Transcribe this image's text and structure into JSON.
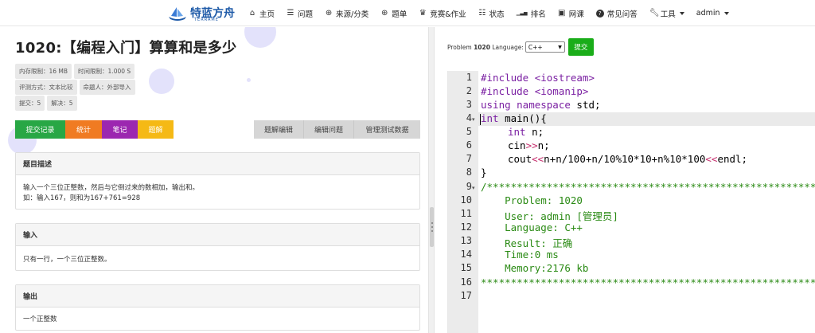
{
  "brand": {
    "name": "特蓝方舟",
    "sub": "TERRAME"
  },
  "nav": {
    "items": [
      {
        "icon": "home-icon",
        "glyph": "⌂",
        "label": "主页"
      },
      {
        "icon": "list-icon",
        "glyph": "☰",
        "label": "问题"
      },
      {
        "icon": "globe-icon",
        "glyph": "⊕",
        "label": "来源/分类"
      },
      {
        "icon": "globe-icon",
        "glyph": "⊕",
        "label": "题单"
      },
      {
        "icon": "trophy-icon",
        "glyph": "♛",
        "label": "竞赛&作业"
      },
      {
        "icon": "list-ol-icon",
        "glyph": "☷",
        "label": "状态"
      },
      {
        "icon": "signal-icon",
        "glyph": "▁▃▅",
        "label": "排名"
      },
      {
        "icon": "video-icon",
        "glyph": "▣",
        "label": "网课"
      },
      {
        "icon": "question-circle-icon",
        "glyph": "?",
        "label": "常见问答"
      }
    ],
    "tools_label": "工具",
    "user_label": "admin"
  },
  "problem": {
    "title": "1020:【编程入门】算算和是多少",
    "badges_row1": [
      "内存限制：16 MB",
      "时间限制：1.000 S"
    ],
    "badges_row2": [
      "评测方式：文本比较",
      "命题人：外部导入"
    ],
    "badges_row3": [
      "提交：5",
      "解决：5"
    ],
    "buttons": {
      "submit_records": "提交记录",
      "stats": "统计",
      "notes": "笔记",
      "solution": "题解",
      "edit_solution": "题解编辑",
      "edit_problem": "编辑问题",
      "manage_tests": "管理测试数据"
    },
    "sections": [
      {
        "heading": "题目描述",
        "body": [
          "输入一个三位正整数，然后与它倒过来的数相加，输出和。",
          "如：输入167，则和为167+761=928"
        ]
      },
      {
        "heading": "输入",
        "body": [
          "只有一行，一个三位正整数。"
        ]
      },
      {
        "heading": "输出",
        "body": [
          "一个正整数"
        ]
      }
    ]
  },
  "submit_bar": {
    "problem_prefix": "Problem",
    "problem_id": "1020",
    "language_label": "Language:",
    "language_value": "C++",
    "submit_label": "提交"
  },
  "editor": {
    "line_numbers": [
      "1",
      "2",
      "3",
      "4",
      "5",
      "6",
      "7",
      "8",
      "9",
      "10",
      "11",
      "12",
      "13",
      "14",
      "15",
      "16",
      "17"
    ],
    "lines": {
      "l1": "#include <iostream>",
      "l2": "#include <iomanip>",
      "l3_kw": "using namespace",
      "l3_rest": " std;",
      "l4_kw": "int",
      "l4_rest": " main(){",
      "l5_kw": "int",
      "l5_rest": " n;",
      "l6_a": "cin",
      "l6_op": ">>",
      "l6_b": "n;",
      "l7_a": "cout",
      "l7_op1": "<<",
      "l7_b": "n+n/100+n/10%10*10+n%10*100",
      "l7_op2": "<<",
      "l7_c": "endl;",
      "l8": "}",
      "l9": "/*****************************************************************",
      "l10": "    Problem: 1020",
      "l11": "    User: admin [管理员]",
      "l12": "    Language: C++",
      "l13": "    Result: 正确",
      "l14": "    Time:0 ms",
      "l15": "    Memory:2176 kb",
      "l16": "******************************************************************"
    }
  },
  "colors": {
    "green": "#28a745",
    "orange": "#f07b22",
    "purple": "#9c27b0",
    "yellow": "#f5b915",
    "submit_green": "#1aad19",
    "brand_blue": "#1e5aa8"
  }
}
